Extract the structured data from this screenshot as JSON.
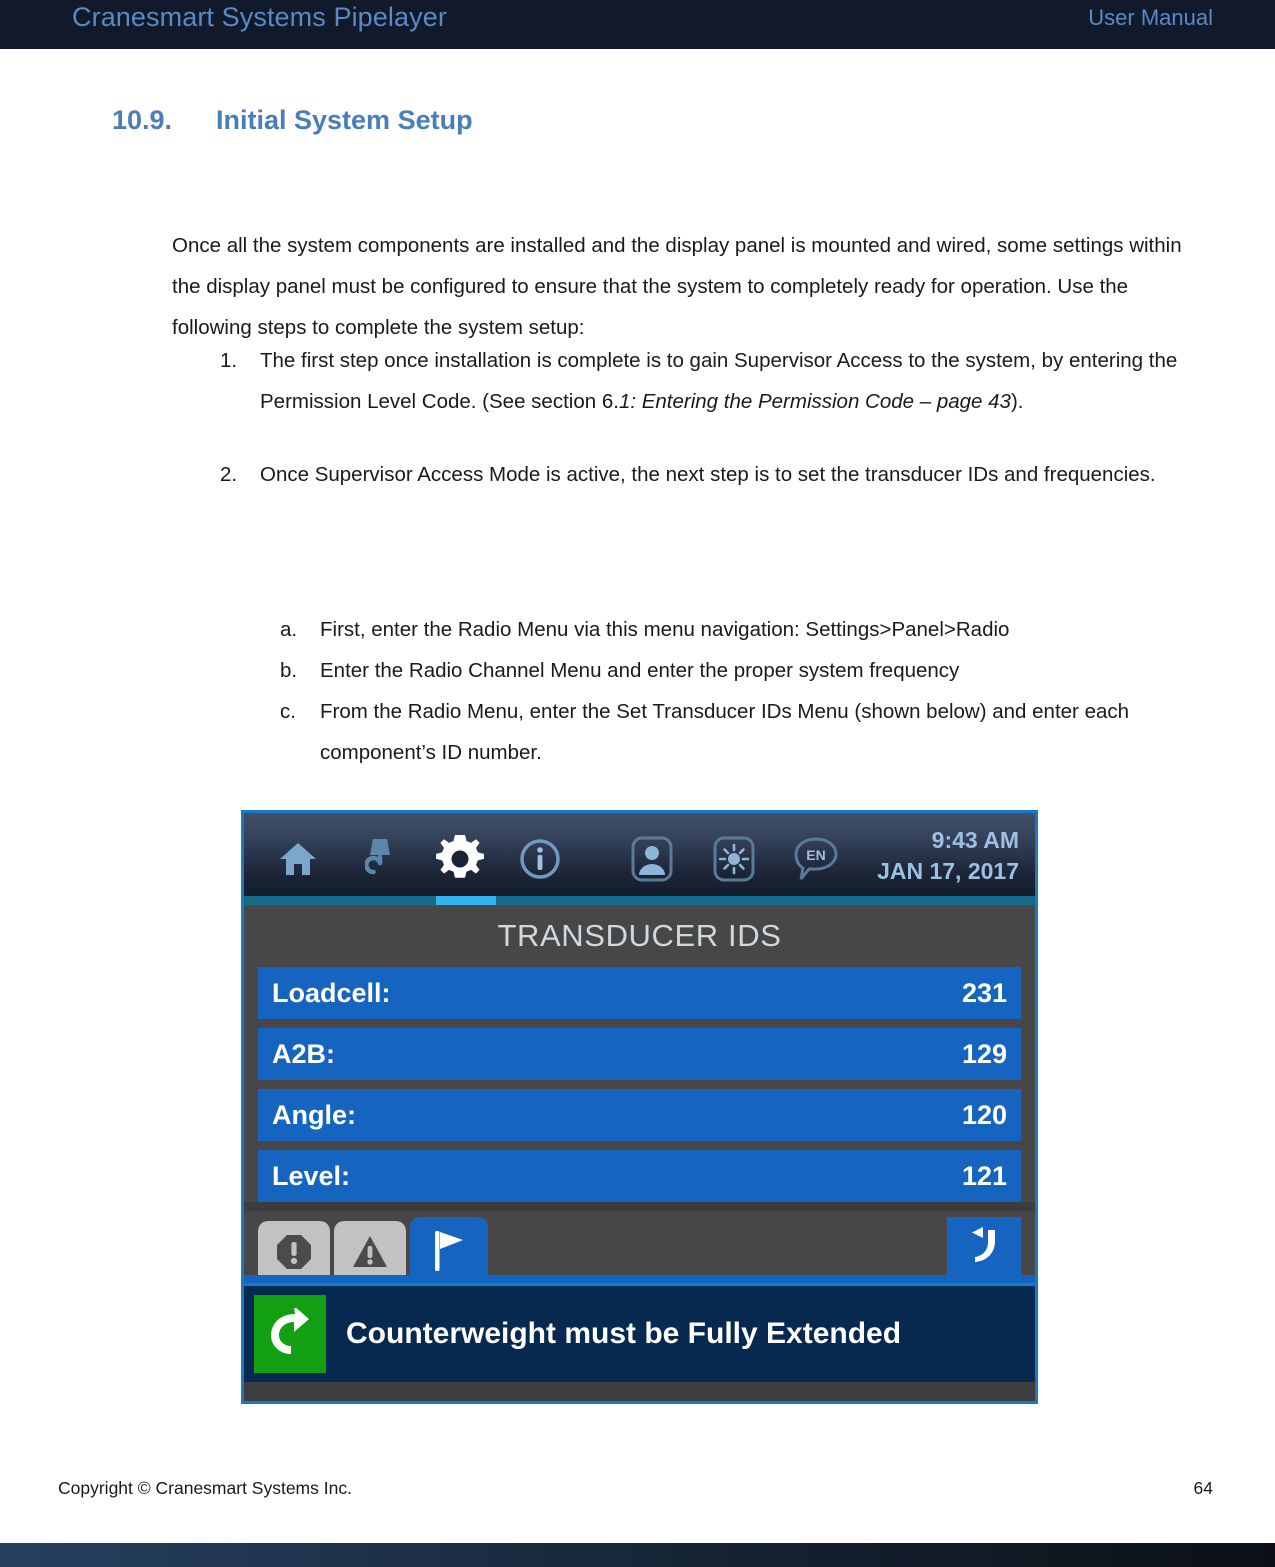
{
  "header": {
    "doc_title": "Cranesmart Systems Pipelayer",
    "doc_kind": "User Manual",
    "bg_color": "#111a2b",
    "text_color": "#5a8ac4"
  },
  "section": {
    "number": "10.9.",
    "title": "Initial System Setup",
    "color": "#4a7ebb"
  },
  "intro_paragraph": "Once all the system components are installed and the display panel is mounted and wired, some settings within the display panel must be configured to ensure that the system to completely ready for operation.  Use the following steps to complete the system setup:",
  "numbered_items": [
    {
      "marker": "1.",
      "text_before_italic": "The first step once installation is complete is to gain Supervisor Access to the system, by entering the Permission Level Code.  (See section 6.",
      "italic_text": "1: Entering the Permission Code – page 43",
      "text_after_italic": ")."
    },
    {
      "marker": "2.",
      "text": "Once Supervisor Access Mode is active, the next step is to set the transducer IDs and frequencies."
    }
  ],
  "lettered_items": [
    {
      "marker": "a.",
      "text": "First, enter the Radio Menu via this menu navigation: Settings>Panel>Radio"
    },
    {
      "marker": "b.",
      "text": "Enter the Radio Channel Menu and enter the proper system frequency"
    },
    {
      "marker": "c.",
      "text": "From the Radio Menu, enter the Set Transducer IDs Menu (shown below) and enter each component’s ID number."
    }
  ],
  "device_screenshot": {
    "toolbar": {
      "icons": [
        {
          "name": "home-icon",
          "label": "Home"
        },
        {
          "name": "crane-hook-icon",
          "label": "Hook"
        },
        {
          "name": "gear-icon",
          "label": "Settings"
        },
        {
          "name": "info-icon",
          "label": "Info"
        },
        {
          "name": "user-icon",
          "label": "User"
        },
        {
          "name": "brightness-icon",
          "label": "Brightness"
        },
        {
          "name": "language-icon",
          "label": "EN"
        }
      ],
      "language_code": "EN",
      "time": "9:43 AM",
      "date": "JAN 17, 2017",
      "active_icon": "gear-icon",
      "active_indicator_color": "#35b3f0"
    },
    "screen_title": "TRANSDUCER IDS",
    "rows": [
      {
        "label": "Loadcell:",
        "value": "231"
      },
      {
        "label": "A2B:",
        "value": "129"
      },
      {
        "label": "Angle:",
        "value": "120"
      },
      {
        "label": "Level:",
        "value": "121"
      }
    ],
    "row_color": "#1565c0",
    "panel_color": "#474747",
    "tabs": [
      {
        "name": "alarm-stop-tab",
        "active": false
      },
      {
        "name": "warning-tab",
        "active": false
      },
      {
        "name": "flag-tab",
        "active": true
      }
    ],
    "back_button": {
      "name": "back-button",
      "label": "Back"
    },
    "status_bar": {
      "message": "Counterweight must be Fully Extended",
      "icon_color": "#12a012",
      "bg_color": "#07294f"
    }
  },
  "footer": {
    "copyright": "Copyright © Cranesmart Systems Inc.",
    "page_number": "64"
  }
}
